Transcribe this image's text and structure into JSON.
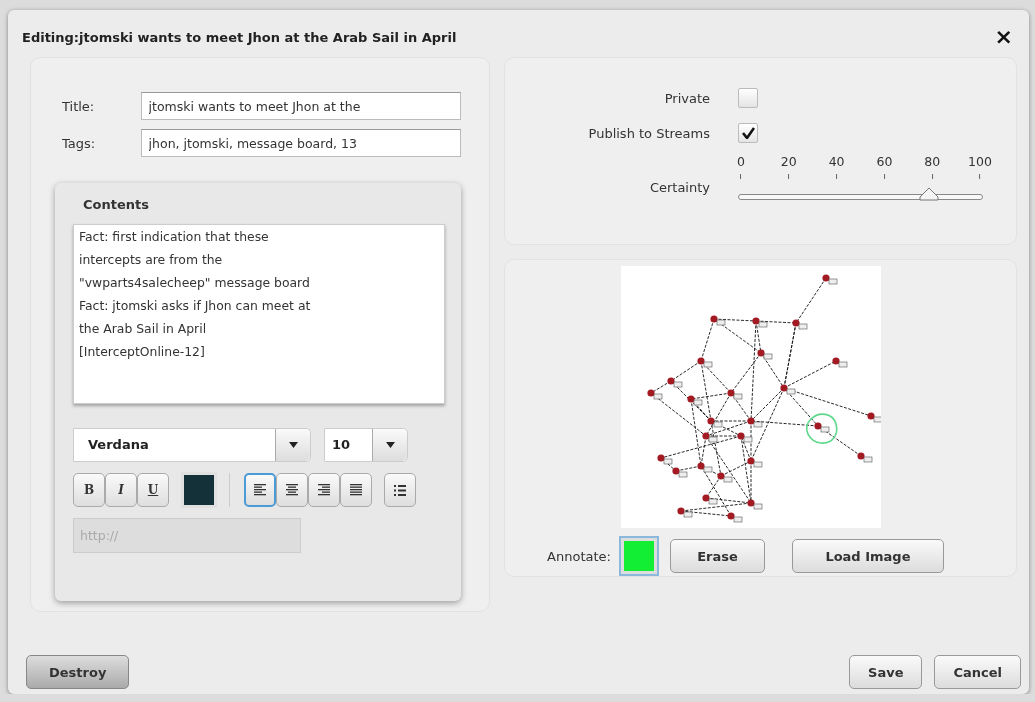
{
  "dialog": {
    "title": "Editing:jtomski wants to meet Jhon at the Arab Sail in April",
    "close": "×"
  },
  "fields": [
    {
      "label": "Title:",
      "value": "jtomski wants to meet Jhon at the"
    },
    {
      "label": "Tags:",
      "value": "jhon, jtomski, message board, 13"
    }
  ],
  "contents": {
    "heading": "Contents",
    "text": "Fact: first indication that these\nintercepts are from the\n\"vwparts4salecheep\" message board\nFact: jtomski asks if Jhon can meet at\nthe Arab Sail in April\n[InterceptOnline-12]",
    "font": "Verdana",
    "size": "10",
    "styles": [
      {
        "kind": "bold",
        "label": "B"
      },
      {
        "kind": "italic",
        "label": "I"
      },
      {
        "kind": "underline",
        "label": "U"
      }
    ],
    "color": "#14313a",
    "align": [
      {
        "kind": "left",
        "selected": true
      },
      {
        "kind": "center",
        "selected": false
      },
      {
        "kind": "right",
        "selected": false
      },
      {
        "kind": "justify",
        "selected": false
      }
    ],
    "link": {
      "placeholder": "http://"
    }
  },
  "options": {
    "checkboxes": [
      {
        "label": "Private",
        "checked": false
      },
      {
        "label": "Publish to Streams",
        "checked": true
      }
    ],
    "certainty": {
      "label": "Certainty",
      "level": 0.78,
      "ticks": [
        "0",
        "20",
        "40",
        "60",
        "80",
        "100"
      ]
    }
  },
  "annotate": {
    "label": "Annotate:",
    "color": "#11ee33",
    "buttons": [
      "Erase",
      "Load Image"
    ]
  },
  "footer": {
    "left": [
      "Destroy"
    ],
    "right": [
      "Save",
      "Cancel"
    ]
  }
}
